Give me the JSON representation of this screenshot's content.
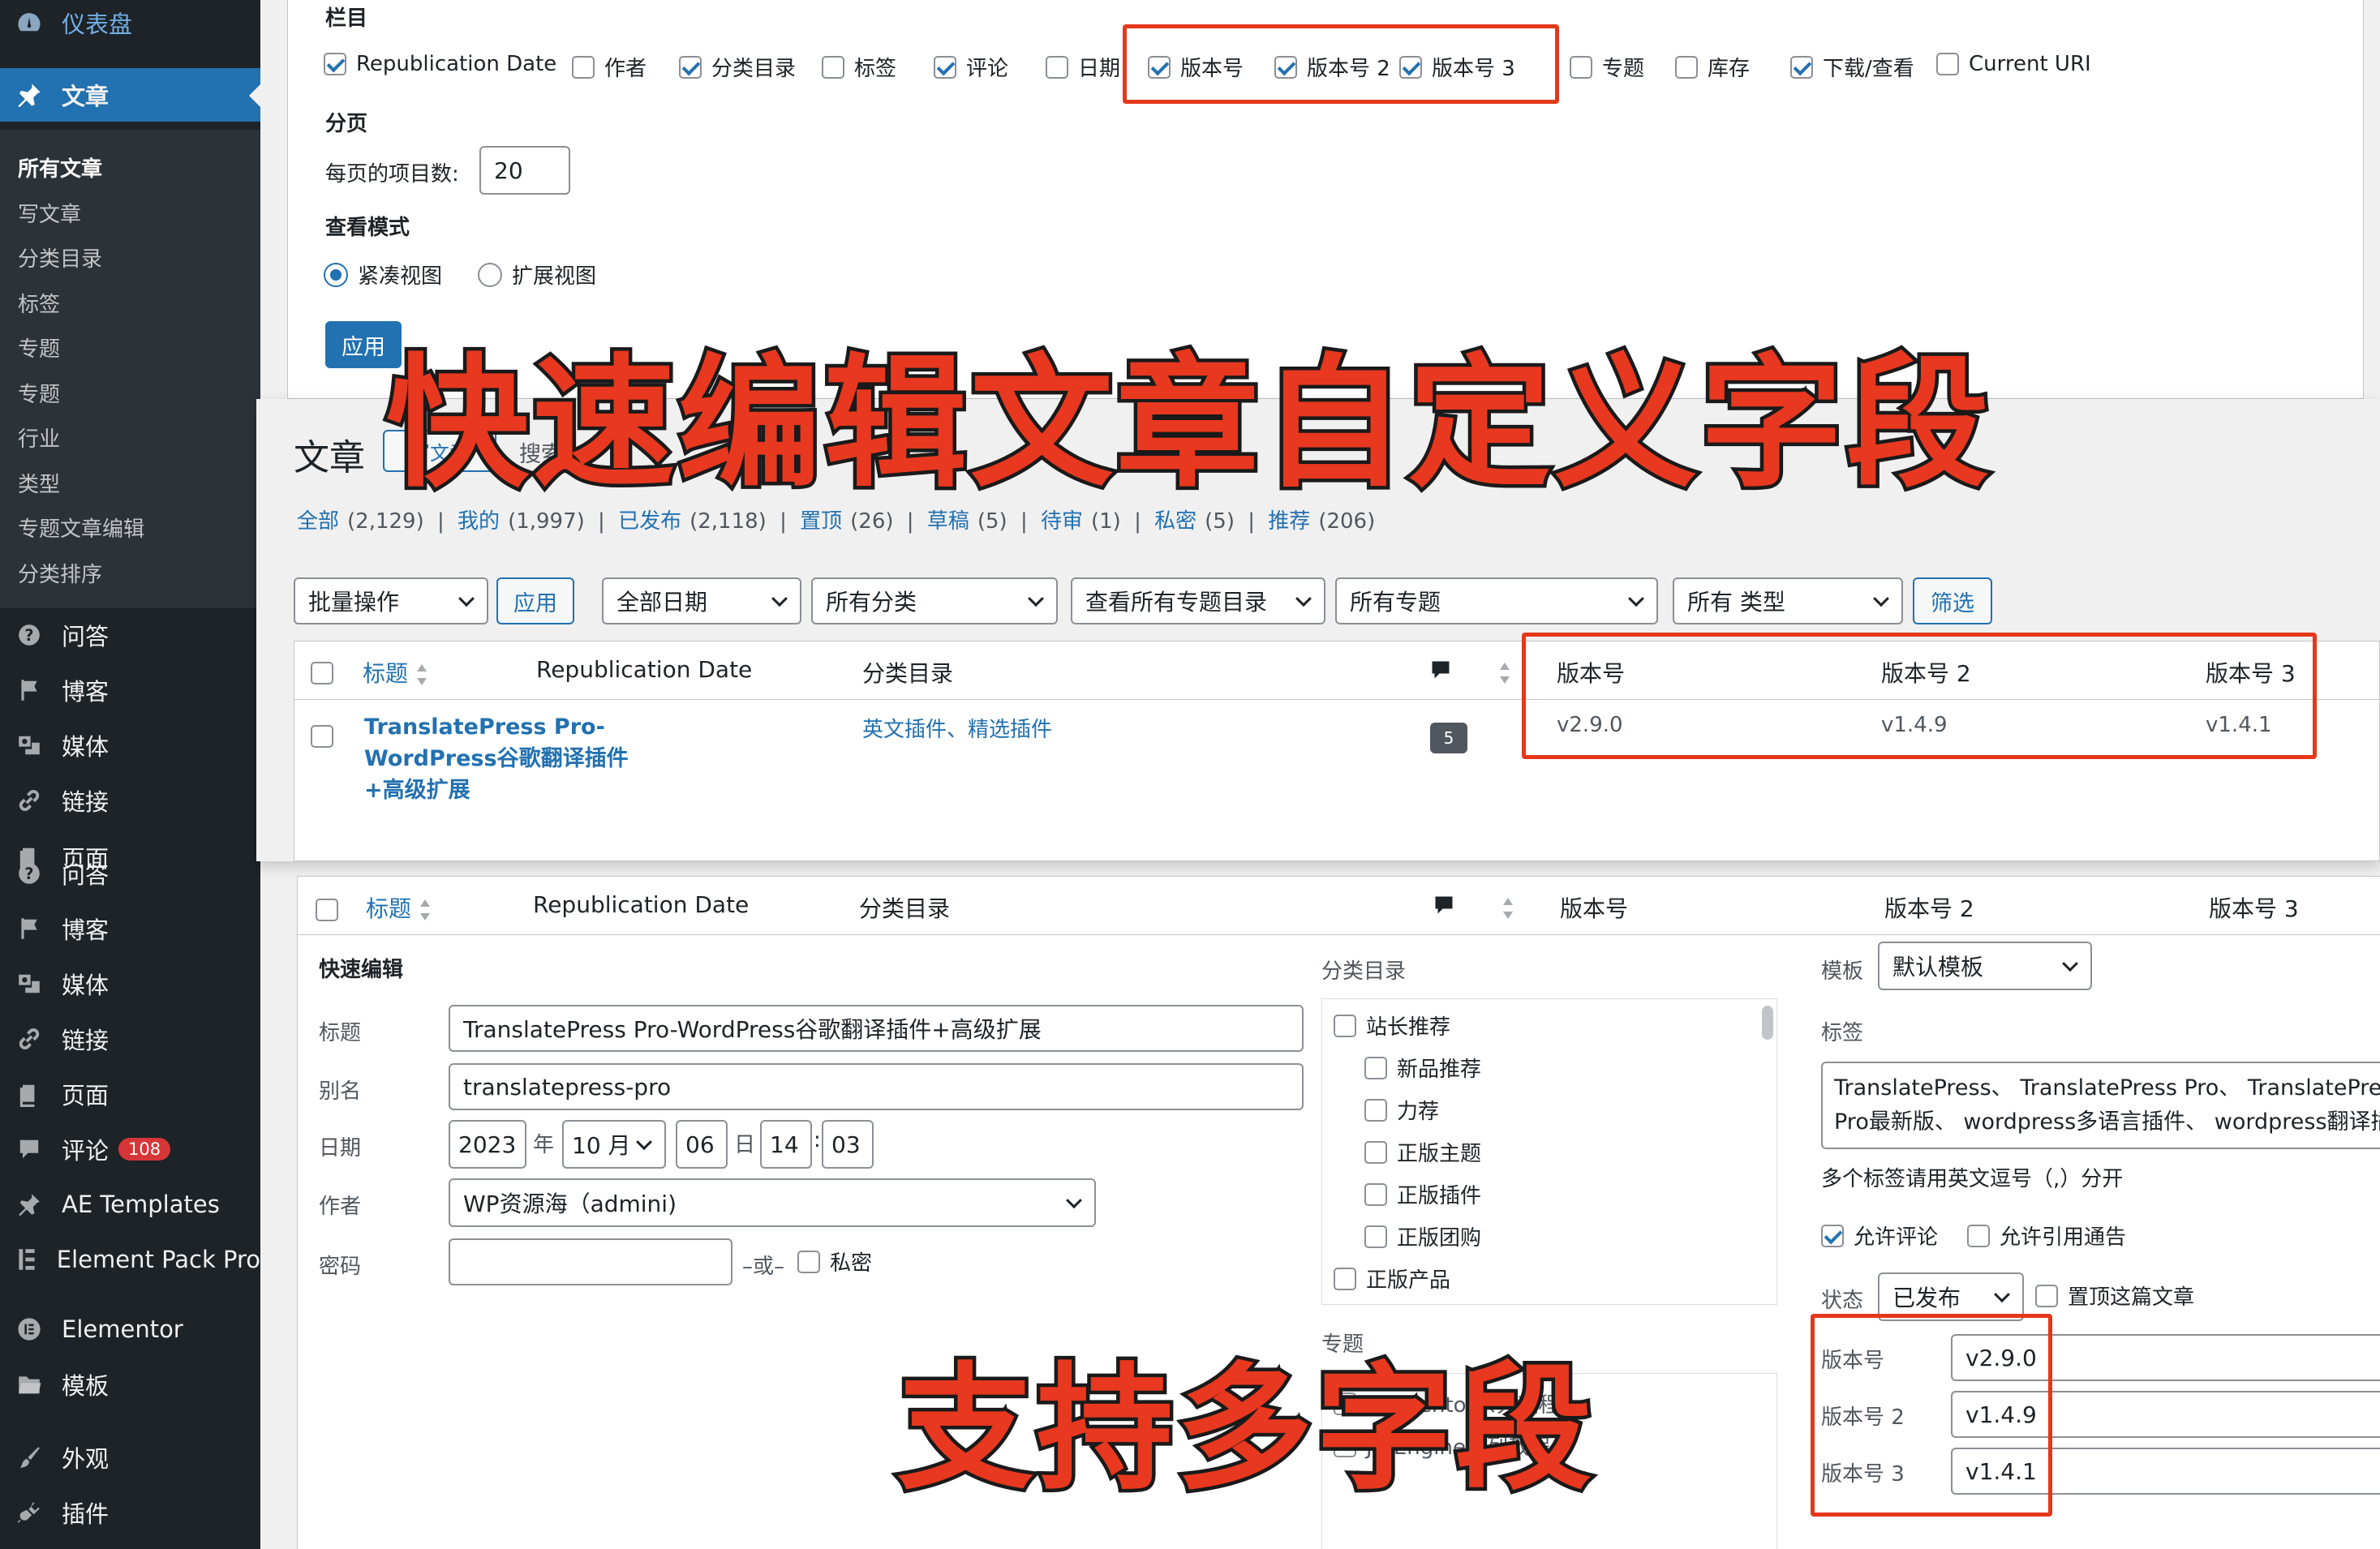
{
  "sidebar": {
    "top_items": [
      {
        "label": "仪表盘",
        "icon": "dashboard-icon"
      },
      {
        "label": "文章",
        "icon": "pushpin-icon"
      }
    ],
    "post_submenu": [
      "所有文章",
      "写文章",
      "分类目录",
      "标签",
      "专题",
      "专题",
      "行业",
      "类型",
      "专题文章编辑",
      "分类排序"
    ],
    "menu_items": [
      {
        "label": "问答",
        "icon": "question-icon"
      },
      {
        "label": "博客",
        "icon": "flag-icon"
      },
      {
        "label": "媒体",
        "icon": "media-icon"
      },
      {
        "label": "链接",
        "icon": "link-icon"
      },
      {
        "label": "页面",
        "icon": "page-icon"
      },
      {
        "label": "问答",
        "icon": "question-icon"
      },
      {
        "label": "博客",
        "icon": "flag-icon"
      },
      {
        "label": "媒体",
        "icon": "media-icon"
      },
      {
        "label": "链接",
        "icon": "link-icon"
      },
      {
        "label": "页面",
        "icon": "page-icon"
      },
      {
        "label": "评论",
        "icon": "comment-icon",
        "badge": "108"
      },
      {
        "label": "AE Templates",
        "icon": "pushpin-icon"
      },
      {
        "label": "Element Pack Pro",
        "icon": "element-pack-icon"
      },
      {
        "label": "Elementor",
        "icon": "elementor-icon"
      },
      {
        "label": "模板",
        "icon": "folder-icon"
      },
      {
        "label": "外观",
        "icon": "brush-icon"
      },
      {
        "label": "插件",
        "icon": "plugin-icon"
      }
    ]
  },
  "screen_options": {
    "columns_heading": "栏目",
    "columns": [
      {
        "label": "Republication Date",
        "checked": true
      },
      {
        "label": "作者",
        "checked": false
      },
      {
        "label": "分类目录",
        "checked": true
      },
      {
        "label": "标签",
        "checked": false
      },
      {
        "label": "评论",
        "checked": true
      },
      {
        "label": "日期",
        "checked": false
      },
      {
        "label": "版本号",
        "checked": true
      },
      {
        "label": "版本号 2",
        "checked": true
      },
      {
        "label": "版本号 3",
        "checked": true
      },
      {
        "label": "专题",
        "checked": false
      },
      {
        "label": "库存",
        "checked": false
      },
      {
        "label": "下载/查看",
        "checked": true
      },
      {
        "label": "Current URI",
        "checked": false
      }
    ],
    "pagination_heading": "分页",
    "per_page_label": "每页的项目数:",
    "per_page_value": "20",
    "view_mode_heading": "查看模式",
    "view_modes": [
      {
        "label": "紧凑视图",
        "checked": true
      },
      {
        "label": "扩展视图",
        "checked": false
      }
    ],
    "apply_label": "应用"
  },
  "posts": {
    "title": "文章",
    "add_new": "写文章",
    "search_fragment": "搜索",
    "views": [
      {
        "label": "全部",
        "count": "(2,129)"
      },
      {
        "label": "我的",
        "count": "(1,997)"
      },
      {
        "label": "已发布",
        "count": "(2,118)"
      },
      {
        "label": "置顶",
        "count": "(26)"
      },
      {
        "label": "草稿",
        "count": "(5)"
      },
      {
        "label": "待审",
        "count": "(1)"
      },
      {
        "label": "私密",
        "count": "(5)"
      },
      {
        "label": "推荐",
        "count": "(206)"
      }
    ],
    "bulk_action": "批量操作",
    "apply_label": "应用",
    "filters": [
      "全部日期",
      "所有分类",
      "查看所有专题目录",
      "所有专题",
      "所有 类型"
    ],
    "filter_button": "筛选",
    "columns": [
      "标题",
      "Republication Date",
      "分类目录",
      "版本号",
      "版本号 2",
      "版本号 3"
    ],
    "rows": [
      {
        "title_lines": [
          "TranslatePress Pro-",
          "WordPress谷歌翻译插件",
          "+高级扩展"
        ],
        "categories": "英文插件、精选插件",
        "comments": "5",
        "version": "v2.9.0",
        "version2": "v1.4.9",
        "version3": "v1.4.1"
      }
    ]
  },
  "quick_edit": {
    "heading": "快速编辑",
    "title_label": "标题",
    "title_value": "TranslatePress Pro-WordPress谷歌翻译插件+高级扩展",
    "slug_label": "别名",
    "slug_value": "translatepress-pro",
    "date_label": "日期",
    "date": {
      "year": "2023",
      "year_unit": "年",
      "month": "10 月",
      "day": "06",
      "day_unit": "日",
      "hour": "14",
      "sep": ":",
      "minute": "03"
    },
    "author_label": "作者",
    "author_value": "WP资源海（admini)",
    "password_label": "密码",
    "or_label": "–或–",
    "private_label": "私密",
    "category_heading": "分类目录",
    "categories": [
      {
        "label": "站长推荐",
        "indent": false
      },
      {
        "label": "新品推荐",
        "indent": true
      },
      {
        "label": "力荐",
        "indent": true
      },
      {
        "label": "正版主题",
        "indent": true
      },
      {
        "label": "正版插件",
        "indent": true
      },
      {
        "label": "正版团购",
        "indent": true
      },
      {
        "label": "正版产品",
        "indent": false
      }
    ],
    "topic_heading": "专题",
    "topic_items": [
      "Elementor系列教程",
      "JetEngine系列教程"
    ],
    "template_label": "模板",
    "template_value": "默认模板",
    "tags_label": "标签",
    "tags_line1": "TranslatePress、 TranslatePress Pro、 TranslatePress",
    "tags_line2": "Pro最新版、 wordpress多语言插件、 wordpress翻译插件",
    "tags_hint": "多个标签请用英文逗号（,）分开",
    "allow_comments": "允许评论",
    "allow_pings": "允许引用通告",
    "status_label": "状态",
    "status_value": "已发布",
    "sticky_label": "置顶这篇文章",
    "fields": [
      {
        "label": "版本号",
        "value": "v2.9.0"
      },
      {
        "label": "版本号 2",
        "value": "v1.4.9"
      },
      {
        "label": "版本号 3",
        "value": "v1.4.1"
      }
    ]
  },
  "overlay": {
    "headline": "快速编辑文章自定义字段",
    "subline": "支持多字段"
  },
  "colors": {
    "accent": "#2271b1",
    "highlight": "#e5371b",
    "sidebar": "#1d2327"
  }
}
